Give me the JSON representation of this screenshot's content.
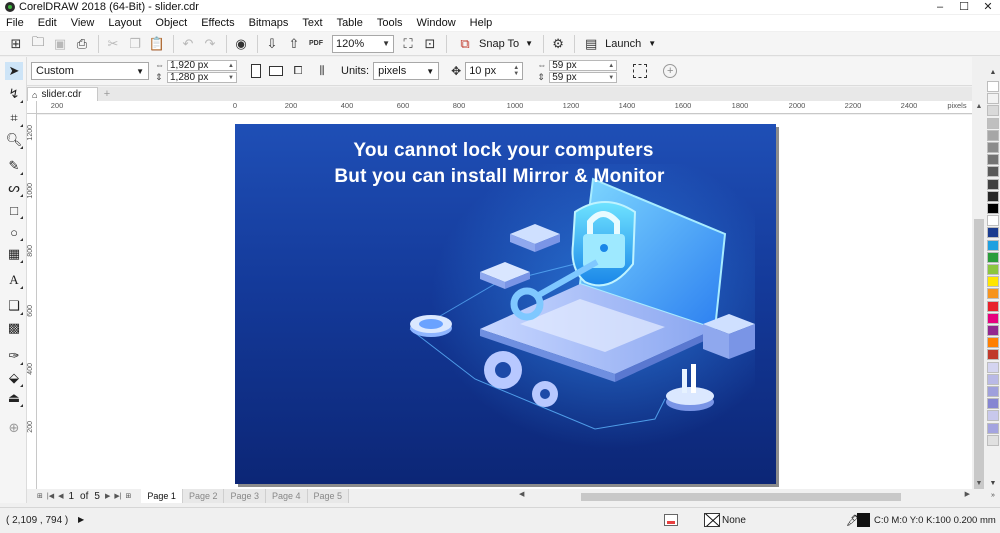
{
  "window": {
    "title": "CorelDRAW 2018 (64-Bit) - slider.cdr",
    "controls": [
      "–",
      "☐",
      "✕"
    ]
  },
  "menu": [
    "File",
    "Edit",
    "View",
    "Layout",
    "Object",
    "Effects",
    "Bitmaps",
    "Text",
    "Table",
    "Tools",
    "Window",
    "Help"
  ],
  "standard_toolbar": {
    "zoom_value": "120%",
    "snap_to_label": "Snap To",
    "launch_label": "Launch",
    "pdf_label": "PDF"
  },
  "property_bar": {
    "preset": "Custom",
    "width": "1,920 px",
    "height": "1,280 px",
    "units_label": "Units:",
    "units_value": "pixels",
    "nudge": "10 px",
    "dup_x": "59 px",
    "dup_y": "59 px"
  },
  "document_tab": {
    "name": "slider.cdr"
  },
  "ruler": {
    "h_labels": [
      "200",
      "0",
      "200",
      "400",
      "600",
      "800",
      "1000",
      "1200",
      "1400",
      "1600",
      "1800",
      "2000",
      "2200",
      "2400"
    ],
    "unit": "pixels",
    "v_labels": [
      "1200",
      "1000",
      "800",
      "600",
      "400",
      "200"
    ]
  },
  "artwork": {
    "line1": "You cannot lock your computers",
    "line2": "But you can install Mirror & Monitor"
  },
  "page_nav": {
    "current": "1",
    "of_label": "of",
    "total": "5",
    "pages": [
      "Page 1",
      "Page 2",
      "Page 3",
      "Page 4",
      "Page 5"
    ]
  },
  "status": {
    "coords": "( 2,109 , 794   )",
    "fill_label": "None",
    "outline_label": "C:0 M:0 Y:0 K:100  0.200 mm"
  },
  "palette_colors": [
    "#ffffff",
    "#f2f2f2",
    "#d9d9d9",
    "#bfbfbf",
    "#a6a6a6",
    "#8c8c8c",
    "#737373",
    "#595959",
    "#404040",
    "#262626",
    "#000000",
    "#ffffff",
    "#1a3b8f",
    "#1fa0e0",
    "#2a9d3a",
    "#8cc63f",
    "#ffe600",
    "#f7941d",
    "#e8212b",
    "#e6007e",
    "#92278f",
    "#ff7f00",
    "#c0392b",
    "#d4d4f0",
    "#b9b9e6",
    "#9fa0dc",
    "#8585d2",
    "#c8c8ec",
    "#a4a4e0",
    "#e0e0e0"
  ]
}
